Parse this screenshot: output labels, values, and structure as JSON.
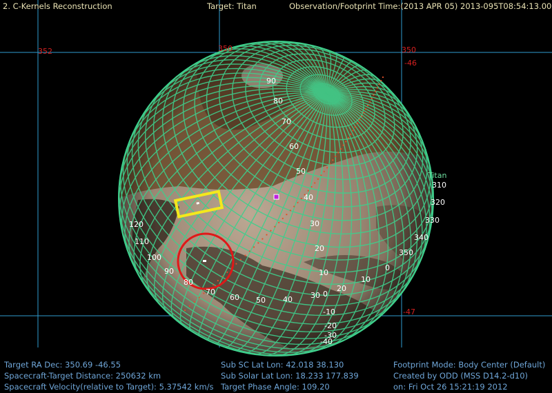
{
  "header": {
    "title": "2. C-Kernels Reconstruction",
    "target": "Target: Titan",
    "observation": "Observation/Footprint Time:(2013 APR 05) 2013-095T08:54:13.00"
  },
  "colors": {
    "header_text": "#e9e2b4",
    "info_text": "#6fa6d8",
    "grid": "#3fcf8c",
    "sky_grid": "#2f9bcf",
    "sky_label": "#d62020",
    "footprint": "#f4e81c",
    "target_circle": "#e01818",
    "marker": "#c020e0",
    "track": "#e4502a"
  },
  "sky_labels": [
    "352",
    "350",
    "350",
    "-46",
    "-47"
  ],
  "body_label": "Titan",
  "lat_labels": [
    "90",
    "80",
    "70",
    "60",
    "50",
    "40",
    "30",
    "20",
    "10",
    "0",
    "-10",
    "-20",
    "-30",
    "-40"
  ],
  "lon_labels_right": [
    "310",
    "320",
    "330",
    "340",
    "350",
    "0",
    "10",
    "20",
    "30"
  ],
  "lon_labels_left": [
    "120",
    "110",
    "100",
    "90",
    "80",
    "70",
    "60",
    "50",
    "40"
  ],
  "info": {
    "left": [
      "Target RA Dec: 350.69  -46.55",
      "Spacecraft-Target Distance:  250632 km",
      "Spacecraft Velocity(relative to Target): 5.37542 km/s"
    ],
    "middle": [
      "Sub SC Lat Lon: 42.018  38.130",
      "Sub Solar Lat Lon: 18.233  177.839",
      "Target Phase Angle: 109.20"
    ],
    "right": [
      "Footprint Mode: Body Center (Default)",
      "Created by ODD (MSS D14.2-d10)",
      "on: Fri Oct 26 15:21:19 2012"
    ]
  }
}
